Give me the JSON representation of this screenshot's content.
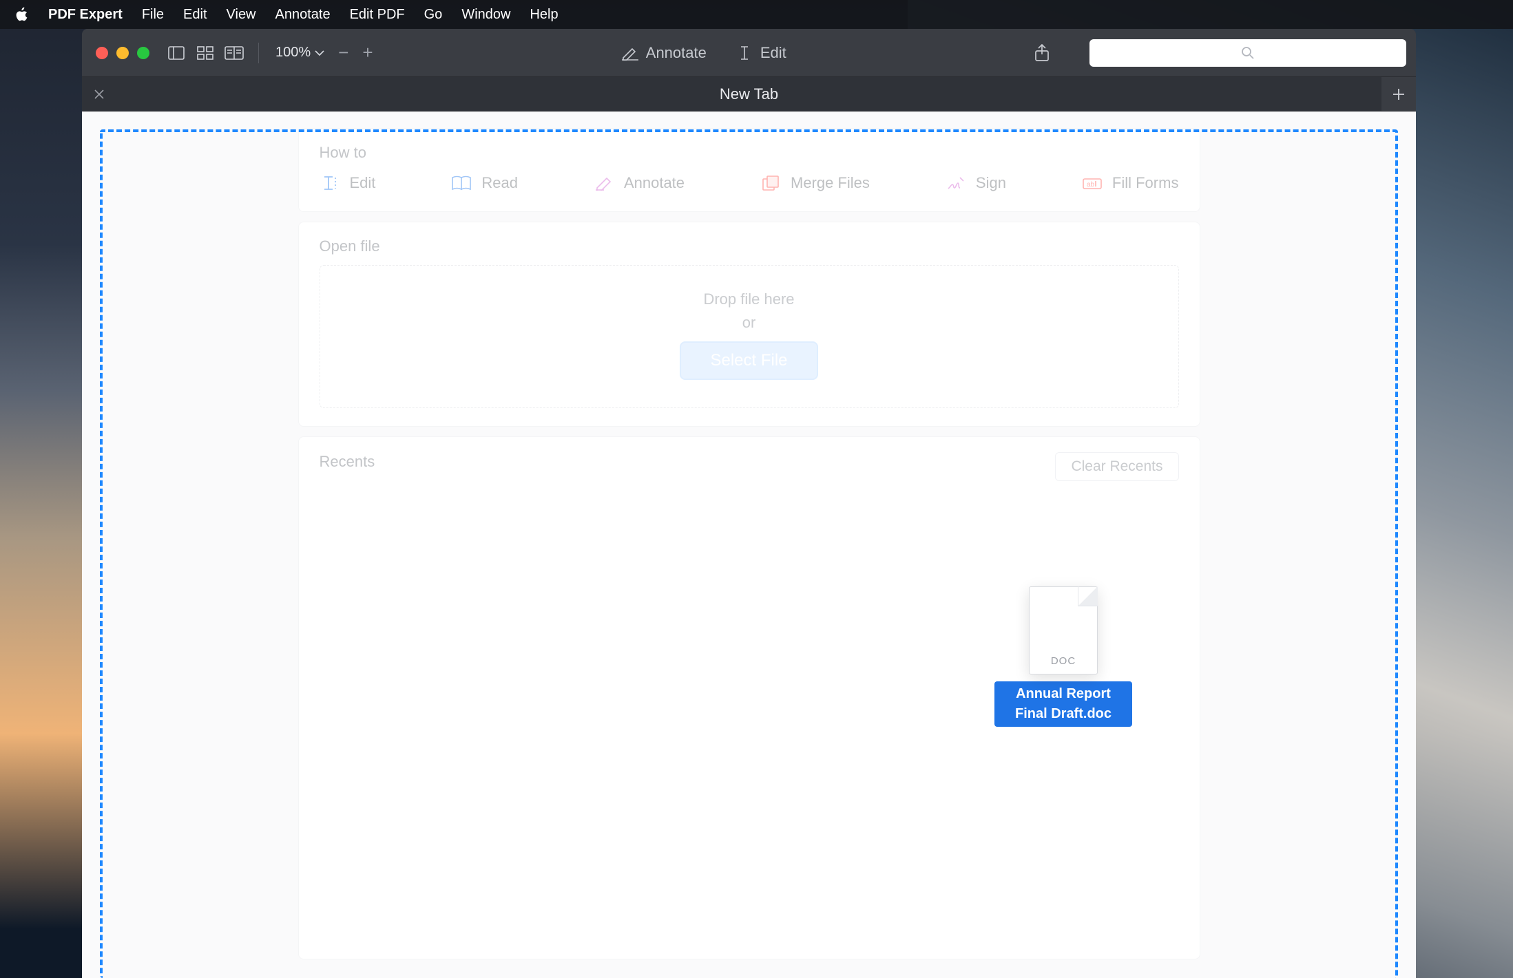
{
  "menubar": {
    "app": "PDF Expert",
    "items": [
      "File",
      "Edit",
      "View",
      "Annotate",
      "Edit PDF",
      "Go",
      "Window",
      "Help"
    ]
  },
  "toolbar": {
    "zoom": "100%",
    "modes": {
      "annotate": "Annotate",
      "edit": "Edit"
    },
    "search_placeholder": ""
  },
  "tab": {
    "title": "New Tab"
  },
  "howto": {
    "heading": "How to",
    "items": [
      {
        "label": "Edit"
      },
      {
        "label": "Read"
      },
      {
        "label": "Annotate"
      },
      {
        "label": "Merge Files"
      },
      {
        "label": "Sign"
      },
      {
        "label": "Fill Forms"
      }
    ]
  },
  "openfile": {
    "heading": "Open file",
    "drop_text": "Drop file here",
    "or_text": "or",
    "button": "Select File"
  },
  "recents": {
    "heading": "Recents",
    "clear": "Clear Recents"
  },
  "drag": {
    "ext": "DOC",
    "filename": "Annual Report Final Draft.doc"
  }
}
